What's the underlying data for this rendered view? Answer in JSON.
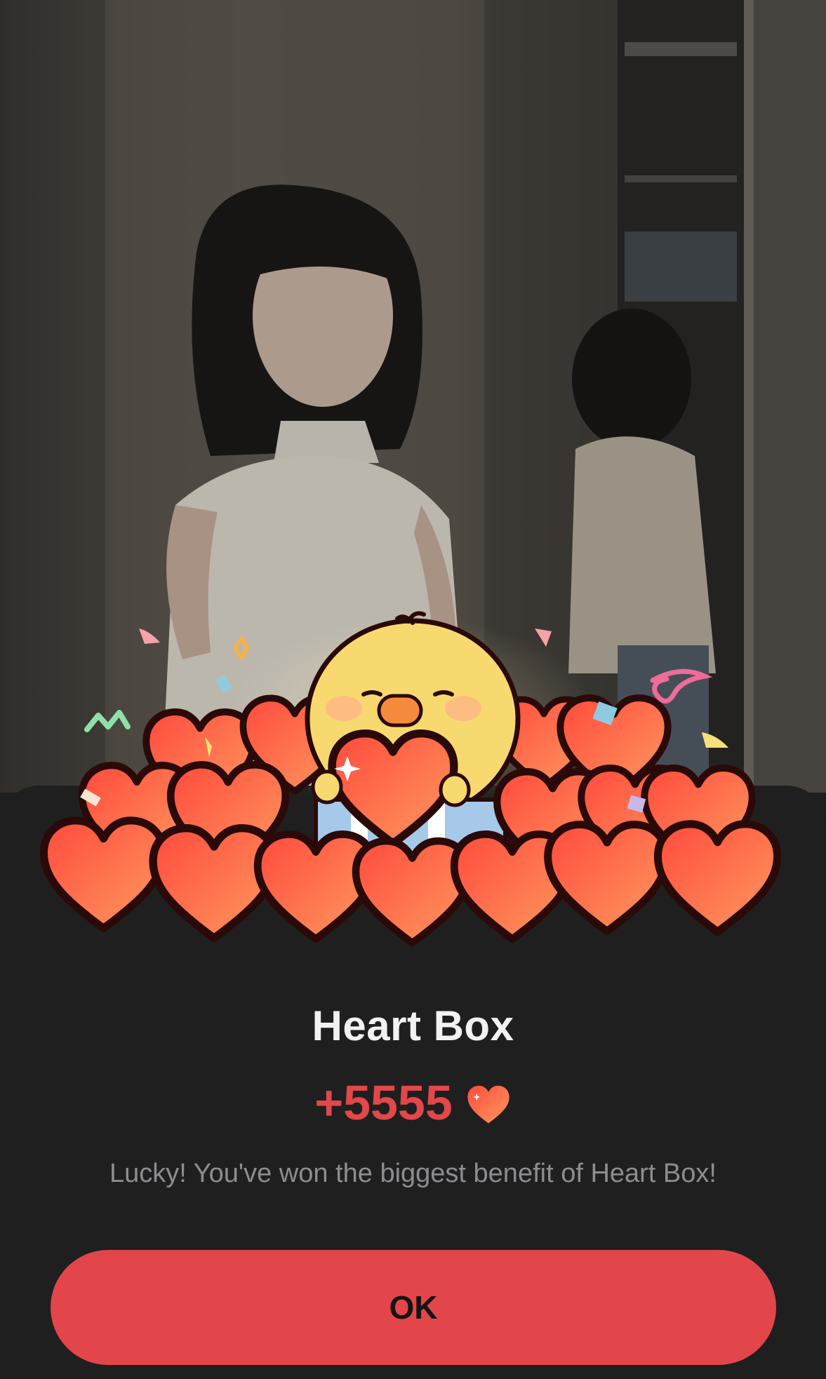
{
  "popup": {
    "title": "Heart Box",
    "reward_amount": "+5555",
    "message": "Lucky! You've won the biggest benefit of Heart Box!",
    "ok_label": "OK",
    "reward_icon": "heart-icon"
  },
  "colors": {
    "accent": "#e2464a",
    "sheet_background": "#1f1f20",
    "reward_text": "#e2474a",
    "message_text": "#8d8d90"
  }
}
